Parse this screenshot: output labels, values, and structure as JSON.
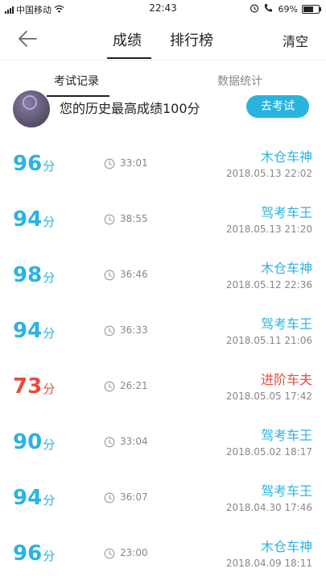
{
  "status_bar": {
    "carrier": "中国移动",
    "time": "22:43",
    "battery": "69%",
    "battery_level": 0.69,
    "icons": [
      "signal-icon",
      "wifi-icon",
      "alarm-icon",
      "hd-call-icon",
      "battery-icon"
    ]
  },
  "nav": {
    "back_icon": "back-arrow-icon",
    "tab_score": "成绩",
    "tab_rank": "排行榜",
    "clear": "清空"
  },
  "subtabs": {
    "records": "考试记录",
    "stats": "数据统计"
  },
  "best": {
    "text": "您的历史最高成绩100分",
    "button": "去考试"
  },
  "colors": {
    "accent": "#2bb3e0",
    "fail": "#e74c3c"
  },
  "records": [
    {
      "score": "96",
      "unit": "分",
      "duration": "33:01",
      "title": "木仓车神",
      "time": "2018.05.13  22:02",
      "color": "blue"
    },
    {
      "score": "94",
      "unit": "分",
      "duration": "38:55",
      "title": "驾考车王",
      "time": "2018.05.13  21:20",
      "color": "blue"
    },
    {
      "score": "98",
      "unit": "分",
      "duration": "36:46",
      "title": "木仓车神",
      "time": "2018.05.12  22:36",
      "color": "blue"
    },
    {
      "score": "94",
      "unit": "分",
      "duration": "36:33",
      "title": "驾考车王",
      "time": "2018.05.11  21:06",
      "color": "blue"
    },
    {
      "score": "73",
      "unit": "分",
      "duration": "26:21",
      "title": "进阶车夫",
      "time": "2018.05.05  17:42",
      "color": "red"
    },
    {
      "score": "90",
      "unit": "分",
      "duration": "33:04",
      "title": "驾考车王",
      "time": "2018.05.02  18:17",
      "color": "blue"
    },
    {
      "score": "94",
      "unit": "分",
      "duration": "36:07",
      "title": "驾考车王",
      "time": "2018.04.30  17:46",
      "color": "blue"
    },
    {
      "score": "96",
      "unit": "分",
      "duration": "23:00",
      "title": "木仓车神",
      "time": "2018.04.09  18:11",
      "color": "blue"
    }
  ]
}
